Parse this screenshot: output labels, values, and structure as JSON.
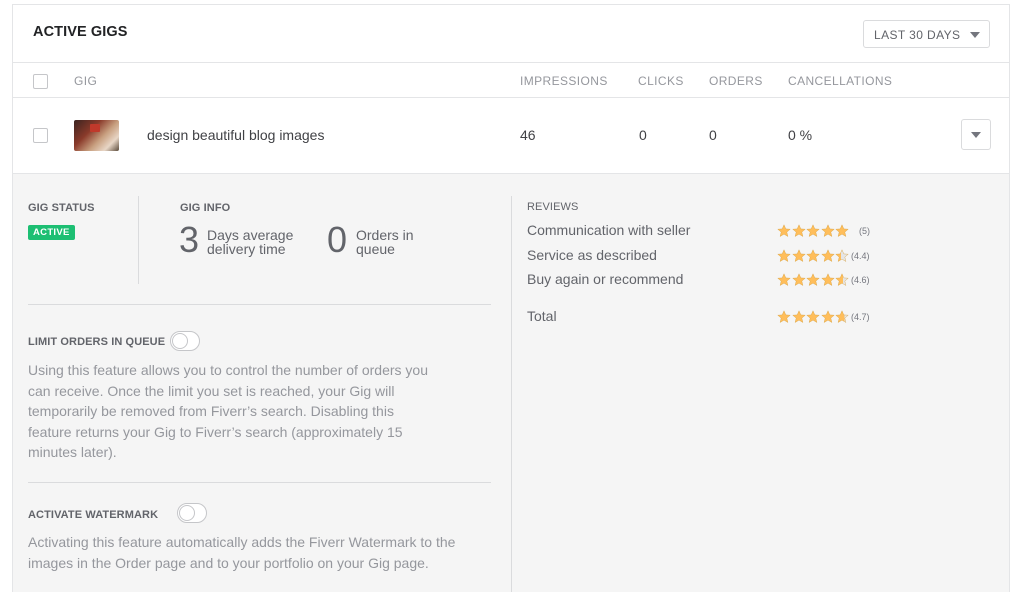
{
  "header": {
    "title": "ACTIVE GIGS",
    "period": "LAST 30 DAYS"
  },
  "columns": [
    "GIG",
    "IMPRESSIONS",
    "CLICKS",
    "ORDERS",
    "CANCELLATIONS"
  ],
  "gig": {
    "title": "design beautiful blog images",
    "impressions": "46",
    "clicks": "0",
    "orders": "0",
    "cancellations": "0 %"
  },
  "details": {
    "status_label": "GIG STATUS",
    "status_badge": "ACTIVE",
    "info_label": "GIG INFO",
    "delivery_days": "3",
    "delivery_text": "Days average delivery time",
    "queue_count": "0",
    "queue_text": "Orders in queue",
    "limit_label": "LIMIT ORDERS IN QUEUE",
    "limit_description": "Using this feature allows you to control the number of orders you can receive. Once the limit you set is reached, your Gig will temporarily be removed from Fiverr’s search. Disabling this feature returns your Gig to Fiverr’s search (approximately 15 minutes later).",
    "watermark_label": "ACTIVATE WATERMARK",
    "watermark_description": "Activating this feature automatically adds the Fiverr Watermark to the images in the Order page and to your portfolio on your Gig page."
  },
  "reviews": {
    "label": "REVIEWS",
    "star_color": "#ffbe5b",
    "items": [
      {
        "label": "Communication with seller",
        "score": "(5)",
        "value": 5
      },
      {
        "label": "Service as described",
        "score": "(4.4)",
        "value": 4.4
      },
      {
        "label": "Buy again or recommend",
        "score": "(4.6)",
        "value": 4.6
      },
      {
        "label": "Total",
        "score": "(4.7)",
        "value": 4.7
      }
    ]
  }
}
